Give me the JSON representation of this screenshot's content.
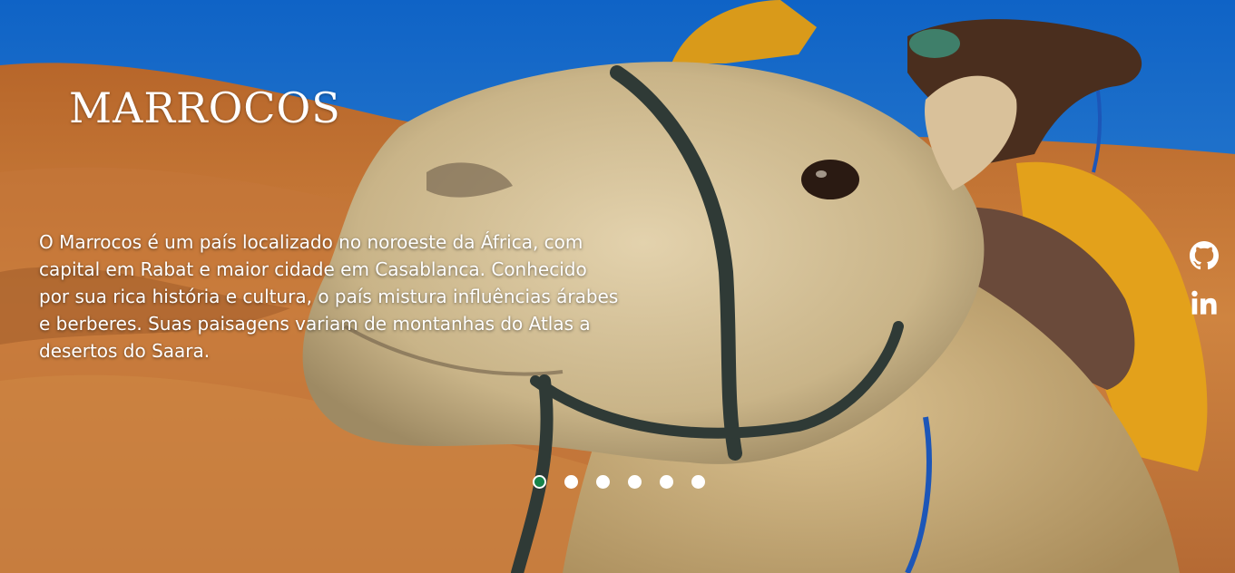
{
  "hero": {
    "title": "MARROCOS",
    "description": "O Marrocos é um país localizado no noroeste da África, com capital em Rabat e maior cidade em Casablanca. Conhecido por sua rica história e cultura, o país mistura influências árabes e berberes. Suas paisagens variam de montanhas do Atlas a desertos do Saara.",
    "background_image": "camel-in-sahara-desert-photo"
  },
  "carousel": {
    "slide_count": 6,
    "active_index": 0,
    "active_color": "#16834a",
    "inactive_color": "#ffffff"
  },
  "social": {
    "github_icon": "github-icon",
    "linkedin_icon": "linkedin-icon"
  },
  "colors": {
    "sky": "#2b78c6",
    "sand": "#c9782e",
    "text": "#ffffff"
  }
}
